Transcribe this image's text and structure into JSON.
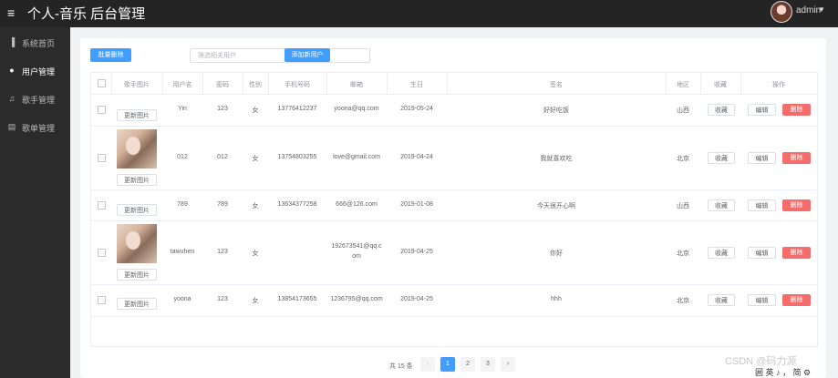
{
  "header": {
    "title": "个人-音乐 后台管理",
    "user": "admin"
  },
  "sidebar": {
    "items": [
      {
        "label": "系统首页",
        "icon": "bar-chart-icon",
        "glyph": "▐"
      },
      {
        "label": "用户管理",
        "icon": "user-icon",
        "glyph": "●"
      },
      {
        "label": "歌手管理",
        "icon": "headphones-icon",
        "glyph": "♫"
      },
      {
        "label": "歌单管理",
        "icon": "document-icon",
        "glyph": "▤"
      }
    ]
  },
  "toolbar": {
    "batch_delete": "批量删除",
    "search_placeholder": "筛选相关用户",
    "add_user": "添加新用户"
  },
  "table": {
    "columns": [
      "歌手图片",
      "用户名",
      "密码",
      "性别",
      "手机号码",
      "邮箱",
      "生日",
      "签名",
      "地区",
      "收藏",
      "操作"
    ],
    "rows": [
      {
        "has_image": false,
        "image_btn": "更新图片",
        "username": "Yin",
        "password": "123",
        "gender": "女",
        "phone": "13776412237",
        "email": "yoona@qq.com",
        "birthday": "2019-05-24",
        "signature": "好好吃饭",
        "region": "山西",
        "fav": "收藏",
        "edit": "编辑",
        "delete": "删除"
      },
      {
        "has_image": true,
        "image_btn": "更新图片",
        "username": "012",
        "password": "012",
        "gender": "女",
        "phone": "13754803255",
        "email": "love@gmail.com",
        "birthday": "2019-04-24",
        "signature": "我就喜欢吃",
        "region": "北京",
        "fav": "收藏",
        "edit": "编辑",
        "delete": "删除"
      },
      {
        "has_image": false,
        "image_btn": "更新图片",
        "username": "789",
        "password": "789",
        "gender": "女",
        "phone": "13634377258",
        "email": "666@126.com",
        "birthday": "2019-01-08",
        "signature": "今天很开心啊",
        "region": "山西",
        "fav": "收藏",
        "edit": "编辑",
        "delete": "删除"
      },
      {
        "has_image": true,
        "image_btn": "更新图片",
        "username": "tawuhen",
        "password": "123",
        "gender": "女",
        "phone": "",
        "email_line1": "192673541@qq.c",
        "email_line2": "om",
        "birthday": "2019-04-25",
        "signature": "你好",
        "region": "北京",
        "fav": "收藏",
        "edit": "编辑",
        "delete": "删除"
      },
      {
        "has_image": false,
        "image_btn": "更新图片",
        "username": "yoona",
        "password": "123",
        "gender": "女",
        "phone": "13854173655",
        "email": "1236795@qq.com",
        "birthday": "2019-04-25",
        "signature": "hhh",
        "region": "北京",
        "fav": "收藏",
        "edit": "编辑",
        "delete": "删除"
      }
    ]
  },
  "pagination": {
    "total": "共 15 条",
    "prev": "‹",
    "next": "›",
    "pages": [
      "1",
      "2",
      "3"
    ],
    "current": "1"
  },
  "watermark": "CSDN @码力源",
  "corner_toolbar": "囲 英 ♪ ， 简 ⚙"
}
